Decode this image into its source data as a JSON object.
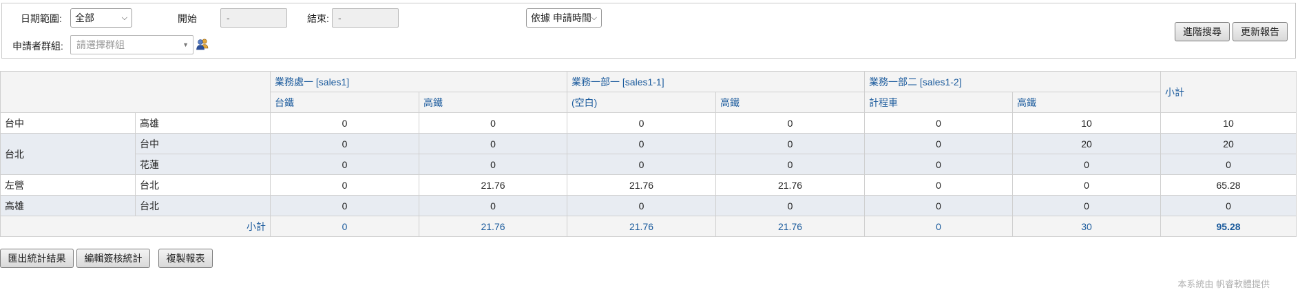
{
  "filters": {
    "date_range_label": "日期範圍:",
    "date_range_value": "全部",
    "start_label": "開始",
    "start_value": "-",
    "end_label": "結束:",
    "end_value": "-",
    "sort_value": "依據 申請時間",
    "group_label": "申請者群組:",
    "group_placeholder": "請選擇群組",
    "advanced_search": "進階搜尋",
    "refresh_report": "更新報告"
  },
  "table": {
    "groups": [
      "業務處一 [sales1]",
      "業務一部一 [sales1-1]",
      "業務一部二 [sales1-2]"
    ],
    "subtotal_header": "小計",
    "sub_columns": [
      "台鐵",
      "高鐵",
      "(空白)",
      "高鐵",
      "計程車",
      "高鐵"
    ],
    "rows": [
      {
        "origin": "台中",
        "dest": "高雄",
        "values": [
          "0",
          "0",
          "0",
          "0",
          "0",
          "10"
        ],
        "subtotal": "10"
      },
      {
        "origin": "台北",
        "dest": "台中",
        "values": [
          "0",
          "0",
          "0",
          "0",
          "0",
          "20"
        ],
        "subtotal": "20"
      },
      {
        "origin": "",
        "dest": "花蓮",
        "values": [
          "0",
          "0",
          "0",
          "0",
          "0",
          "0"
        ],
        "subtotal": "0"
      },
      {
        "origin": "左營",
        "dest": "台北",
        "values": [
          "0",
          "21.76",
          "21.76",
          "21.76",
          "0",
          "0"
        ],
        "subtotal": "65.28"
      },
      {
        "origin": "高雄",
        "dest": "台北",
        "values": [
          "0",
          "0",
          "0",
          "0",
          "0",
          "0"
        ],
        "subtotal": "0"
      }
    ],
    "footer_label": "小計",
    "footer_values": [
      "0",
      "21.76",
      "21.76",
      "21.76",
      "0",
      "30"
    ],
    "footer_total": "95.28"
  },
  "actions": {
    "export": "匯出統計結果",
    "edit_stats": "編輯簽核統計",
    "copy_report": "複製報表"
  },
  "footer_note": "本系統由 帆睿軟體提供"
}
